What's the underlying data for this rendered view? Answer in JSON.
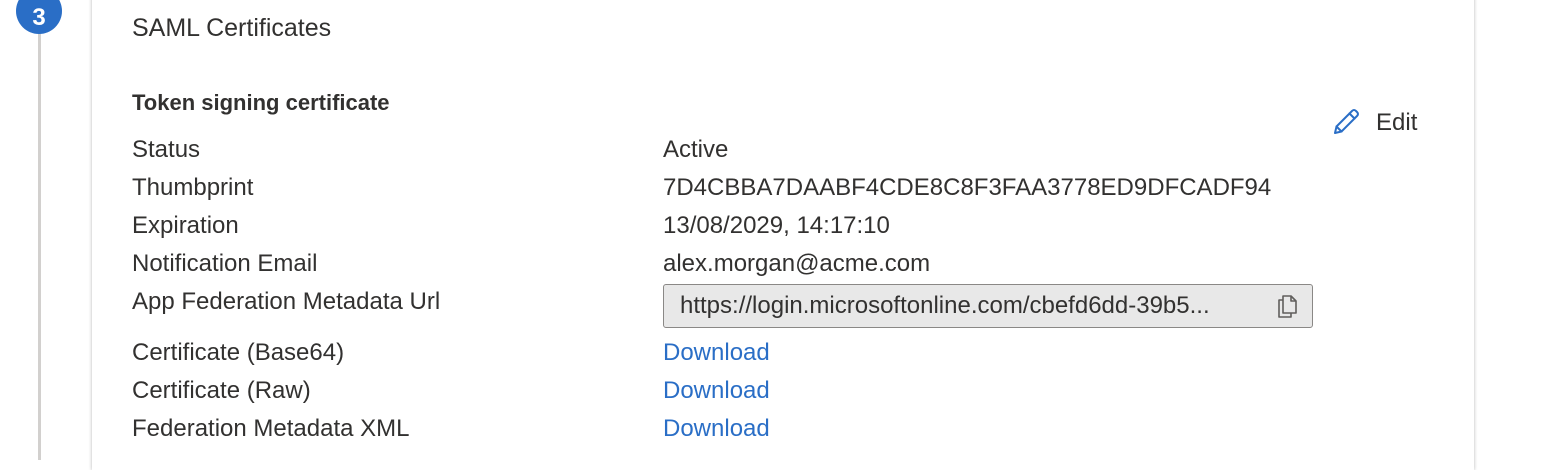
{
  "step": {
    "number": "3"
  },
  "card": {
    "title": "SAML Certificates",
    "section_title": "Token signing certificate",
    "edit_label": "Edit"
  },
  "fields": {
    "status": {
      "label": "Status",
      "value": "Active"
    },
    "thumbprint": {
      "label": "Thumbprint",
      "value": "7D4CBBA7DAABF4CDE8C8F3FAA3778ED9DFCADF94"
    },
    "expiration": {
      "label": "Expiration",
      "value": "13/08/2029, 14:17:10"
    },
    "notification_email": {
      "label": "Notification Email",
      "value": "alex.morgan@acme.com"
    },
    "metadata_url": {
      "label": "App Federation Metadata Url",
      "value": "https://login.microsoftonline.com/cbefd6dd-39b5..."
    },
    "cert_base64": {
      "label": "Certificate (Base64)",
      "link": "Download"
    },
    "cert_raw": {
      "label": "Certificate (Raw)",
      "link": "Download"
    },
    "federation_xml": {
      "label": "Federation Metadata XML",
      "link": "Download"
    }
  },
  "icons": {
    "edit": "pencil-icon",
    "copy": "copy-icon"
  },
  "colors": {
    "accent": "#2a6ec6",
    "text": "#323130",
    "input_bg": "#e8e8e8"
  }
}
